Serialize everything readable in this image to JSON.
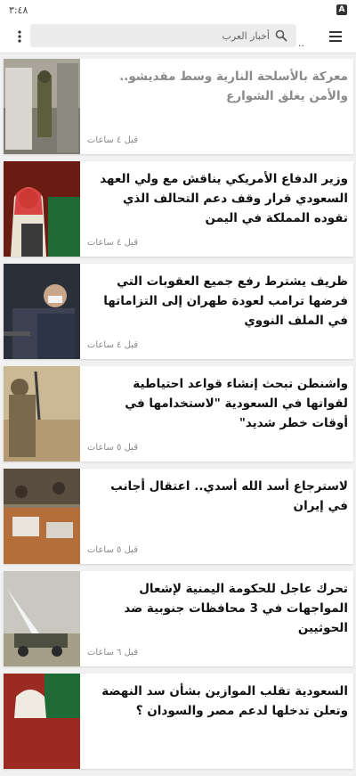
{
  "status_bar": {
    "time": "٣:٤٨",
    "indicator": "A"
  },
  "toolbar": {
    "search_text": "أخبار العرب",
    "dots": "..",
    "icons": [
      "more-vert-icon",
      "search-icon",
      "hamburger-menu-icon"
    ]
  },
  "articles": [
    {
      "title": "معركة بالأسلحة النارية وسط مقديشو.. والأمن يغلق الشوارع",
      "time": "قبل ٤ ساعات",
      "read": true
    },
    {
      "title": "وزير الدفاع الأمريكي يناقش مع ولي العهد السعودي قرار وقف دعم التحالف الذي تقوده المملكة في اليمن",
      "time": "قبل ٤ ساعات",
      "read": false
    },
    {
      "title": "ظريف يشترط رفع جميع العقوبات التي فرضها ترامب لعودة طهران إلى التزاماتها في الملف النووي",
      "time": "قبل ٤ ساعات",
      "read": false
    },
    {
      "title": "واشنطن تبحث إنشاء قواعد احتياطية لقواتها في السعودية \"لاستخدامها في أوقات خطر شديد\"",
      "time": "قبل ٥ ساعات",
      "read": false
    },
    {
      "title": "لاسترجاع أسد الله أسدي.. اعتقال أجانب في إيران",
      "time": "قبل ٥ ساعات",
      "read": false
    },
    {
      "title": "تحرك عاجل للحكومة اليمنية لإشعال المواجهات في 3 محافظات جنوبية ضد الحوثيين",
      "time": "قبل ٦ ساعات",
      "read": false
    },
    {
      "title": "السعودية تقلب الموازين بشأن سد النهضة وتعلن تدخلها لدعم مصر والسودان ؟",
      "time": "",
      "read": false
    }
  ]
}
